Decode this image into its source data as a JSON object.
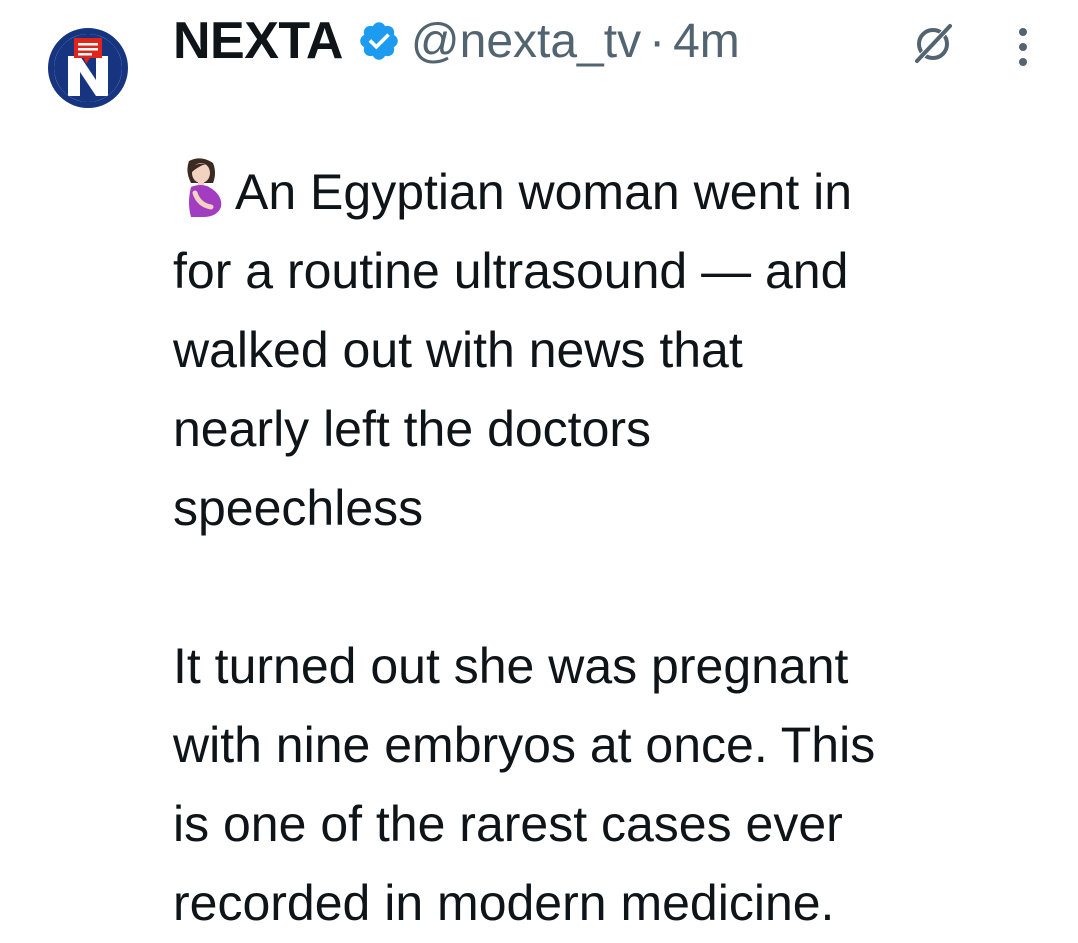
{
  "tweet": {
    "author_name": "NEXTA",
    "handle": "@nexta_tv",
    "separator": "·",
    "time_ago": "4m",
    "verified": true,
    "emoji_icon": "pregnant-woman-emoji",
    "paragraph_1": "An Egyptian woman went in\nfor a routine ultrasound — and\nwalked out with news that\nnearly left the doctors\nspeechless",
    "paragraph_2": "It turned out she was pregnant\nwith nine embryos at once. This\nis one of the rarest cases ever\nrecorded in modern medicine."
  },
  "colors": {
    "text": "#0f1419",
    "secondary": "#536471",
    "verified": "#1d9bf0",
    "avatar_blue": "#16347f",
    "avatar_red": "#e0241c"
  },
  "icons": {
    "verified": "verified-badge-icon",
    "grok": "grok-icon",
    "more": "more-options-icon"
  }
}
